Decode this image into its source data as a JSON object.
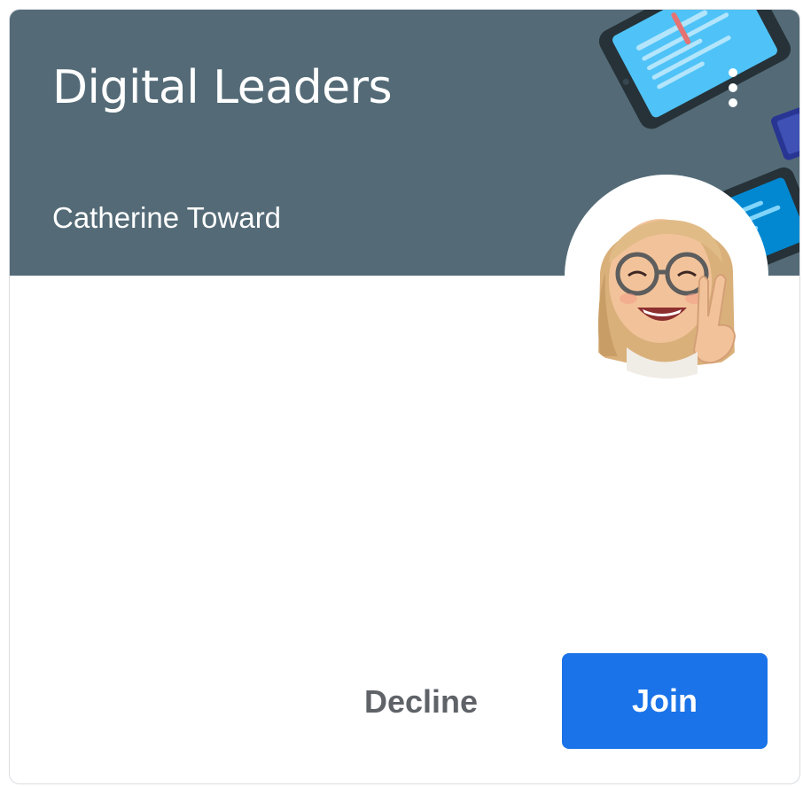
{
  "card": {
    "class_title": "Digital Leaders",
    "teacher_name": "Catherine Toward",
    "header_color": "#546b77",
    "more_icon": "more-vert-icon",
    "avatar_icon": "memoji-avatar"
  },
  "actions": {
    "decline_label": "Decline",
    "join_label": "Join",
    "join_color": "#1a73e8"
  }
}
